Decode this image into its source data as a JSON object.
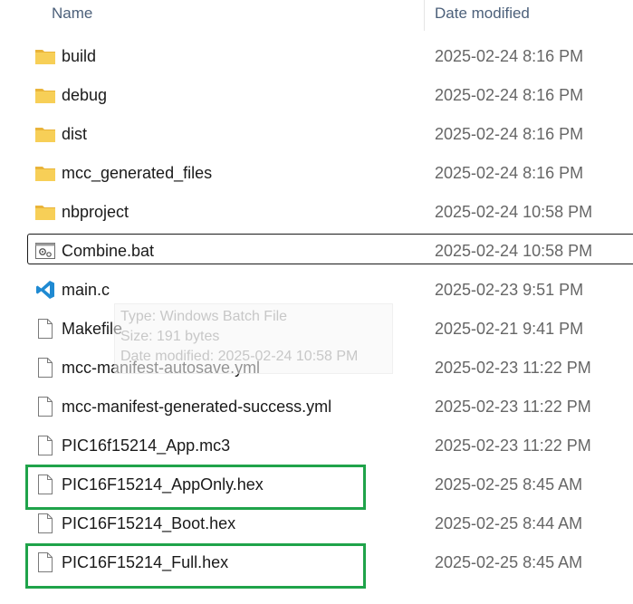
{
  "columns": {
    "name": "Name",
    "date_modified": "Date modified"
  },
  "files": [
    {
      "name": "build",
      "date": "2025-02-24 8:16 PM",
      "icon": "folder-icon"
    },
    {
      "name": "debug",
      "date": "2025-02-24 8:16 PM",
      "icon": "folder-icon"
    },
    {
      "name": "dist",
      "date": "2025-02-24 8:16 PM",
      "icon": "folder-icon"
    },
    {
      "name": "mcc_generated_files",
      "date": "2025-02-24 8:16 PM",
      "icon": "folder-icon"
    },
    {
      "name": "nbproject",
      "date": "2025-02-24 10:58 PM",
      "icon": "folder-icon"
    },
    {
      "name": "Combine.bat",
      "date": "2025-02-24 10:58 PM",
      "icon": "batch-file-icon"
    },
    {
      "name": "main.c",
      "date": "2025-02-23 9:51 PM",
      "icon": "vscode-icon"
    },
    {
      "name": "Makefile",
      "date": "2025-02-21 9:41 PM",
      "icon": "file-icon"
    },
    {
      "name": "mcc-manifest-autosave.yml",
      "date": "2025-02-23 11:22 PM",
      "icon": "file-icon"
    },
    {
      "name": "mcc-manifest-generated-success.yml",
      "date": "2025-02-23 11:22 PM",
      "icon": "file-icon"
    },
    {
      "name": "PIC16f15214_App.mc3",
      "date": "2025-02-23 11:22 PM",
      "icon": "file-icon"
    },
    {
      "name": "PIC16F15214_AppOnly.hex",
      "date": "2025-02-25 8:45 AM",
      "icon": "file-icon"
    },
    {
      "name": "PIC16F15214_Boot.hex",
      "date": "2025-02-25 8:44 AM",
      "icon": "file-icon"
    },
    {
      "name": "PIC16F15214_Full.hex",
      "date": "2025-02-25 8:45 AM",
      "icon": "file-icon"
    }
  ],
  "tooltip": {
    "type": "Type: Windows Batch File",
    "size": "Size: 191 bytes",
    "date": "Date modified: 2025-02-24 10:58 PM"
  },
  "colors": {
    "highlight": "#1fa34a",
    "folder": "#f5c542",
    "vscode": "#1f8ad2"
  }
}
